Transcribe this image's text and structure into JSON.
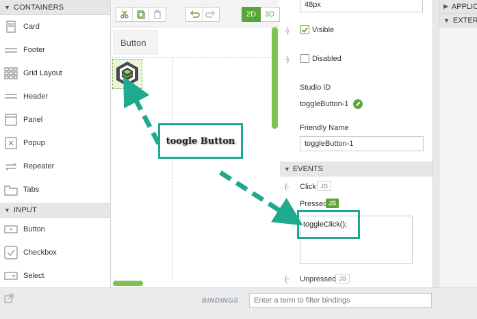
{
  "left_panel": {
    "containers_header": "CONTAINERS",
    "containers": [
      {
        "label": "Card",
        "icon": "card-icon"
      },
      {
        "label": "Footer",
        "icon": "footer-icon"
      },
      {
        "label": "Grid Layout",
        "icon": "grid-layout-icon"
      },
      {
        "label": "Header",
        "icon": "header-icon"
      },
      {
        "label": "Panel",
        "icon": "panel-icon"
      },
      {
        "label": "Popup",
        "icon": "popup-icon"
      },
      {
        "label": "Repeater",
        "icon": "repeater-icon"
      },
      {
        "label": "Tabs",
        "icon": "tabs-icon"
      }
    ],
    "input_header": "INPUT",
    "inputs": [
      {
        "label": "Button",
        "icon": "button-icon"
      },
      {
        "label": "Checkbox",
        "icon": "checkbox-icon"
      },
      {
        "label": "Select",
        "icon": "select-icon"
      }
    ]
  },
  "toolbar": {
    "view_2d": "2D",
    "view_3d": "3D"
  },
  "canvas": {
    "button_label": "Button"
  },
  "properties": {
    "size_value": "48px",
    "visible_label": "Visible",
    "visible_checked": true,
    "disabled_label": "Disabled",
    "disabled_checked": false,
    "studio_id_label": "Studio ID",
    "studio_id_value": "toggleButton-1",
    "friendly_name_label": "Friendly Name",
    "friendly_name_value": "toggleButton-1",
    "bind_arrow": "-)",
    "events_header": "EVENTS",
    "event_arrow": "(-",
    "events": {
      "click": "Click",
      "pressed": "Pressed",
      "unpressed": "Unpressed",
      "js_badge": "JS"
    },
    "pressed_code": "toggleClick();"
  },
  "right_panel": {
    "items": [
      "APPLICATION",
      "EXTERNAL"
    ]
  },
  "bindings": {
    "title": "BINDINGS",
    "filter_placeholder": "Enter a term to filter bindings"
  },
  "annotation": {
    "callout_text": "toogle Button",
    "accent": "#1fa98e"
  },
  "colors": {
    "brand_green": "#5aa537",
    "scroll_green": "#7dc252"
  }
}
